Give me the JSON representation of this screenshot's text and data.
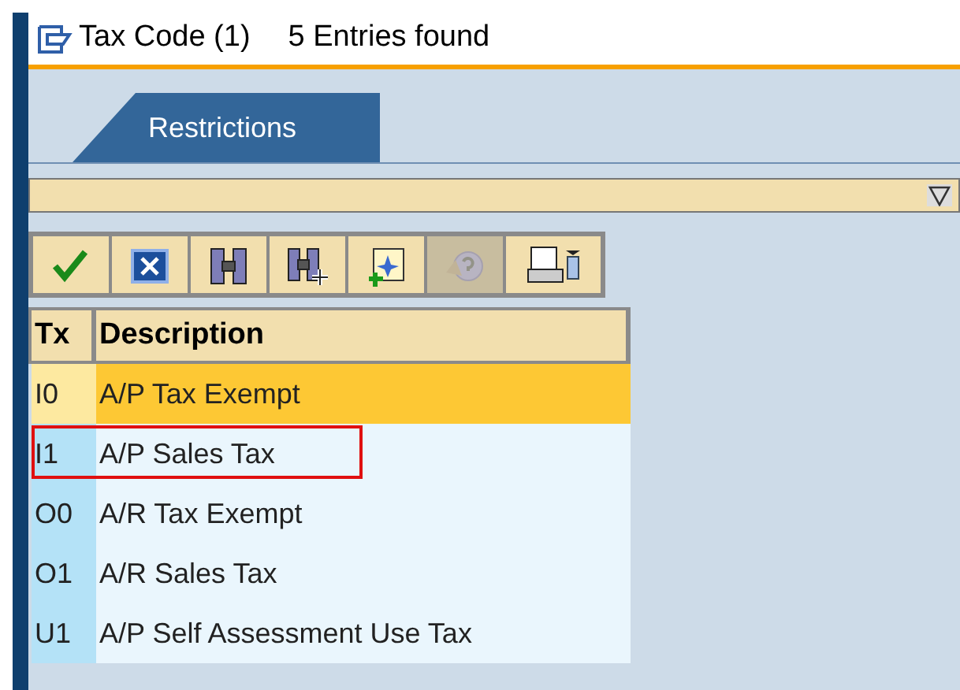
{
  "window": {
    "title": "Tax Code (1)",
    "subtitle": "5 Entries found"
  },
  "tabs": [
    {
      "label": "Restrictions",
      "selected": true
    }
  ],
  "toolbar": [
    {
      "kind": "check",
      "disabled": false
    },
    {
      "kind": "cancel",
      "disabled": false
    },
    {
      "kind": "find",
      "disabled": false
    },
    {
      "kind": "find-next",
      "disabled": false
    },
    {
      "kind": "new",
      "disabled": false
    },
    {
      "kind": "help",
      "disabled": true
    },
    {
      "kind": "print",
      "disabled": false
    }
  ],
  "table": {
    "columns": [
      "Tx",
      "Description"
    ],
    "rows": [
      {
        "cells": [
          "I0",
          "A/P Tax Exempt"
        ],
        "selected": true,
        "outlined": false
      },
      {
        "cells": [
          "I1",
          "A/P Sales Tax"
        ],
        "selected": false,
        "outlined": true
      },
      {
        "cells": [
          "O0",
          "A/R Tax Exempt"
        ],
        "selected": false,
        "outlined": false
      },
      {
        "cells": [
          "O1",
          "A/R Sales Tax"
        ],
        "selected": false,
        "outlined": false
      },
      {
        "cells": [
          "U1",
          "A/P Self Assessment Use Tax"
        ],
        "selected": false,
        "outlined": false
      }
    ]
  }
}
